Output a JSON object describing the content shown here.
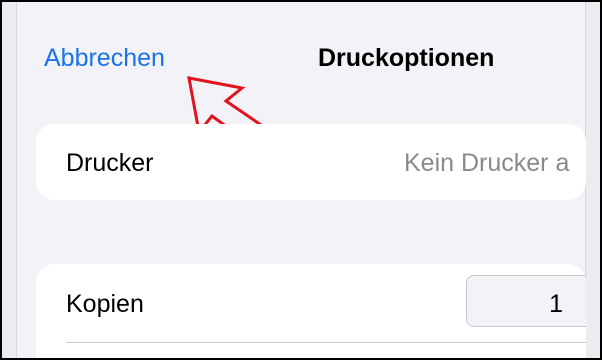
{
  "nav": {
    "cancel_label": "Abbrechen",
    "title": "Druckoptionen"
  },
  "printer_row": {
    "label": "Drucker",
    "value": "Kein Drucker a"
  },
  "copies_row": {
    "label": "Kopien",
    "value": "1"
  },
  "annotation": {
    "arrow_color": "#e0141e"
  }
}
